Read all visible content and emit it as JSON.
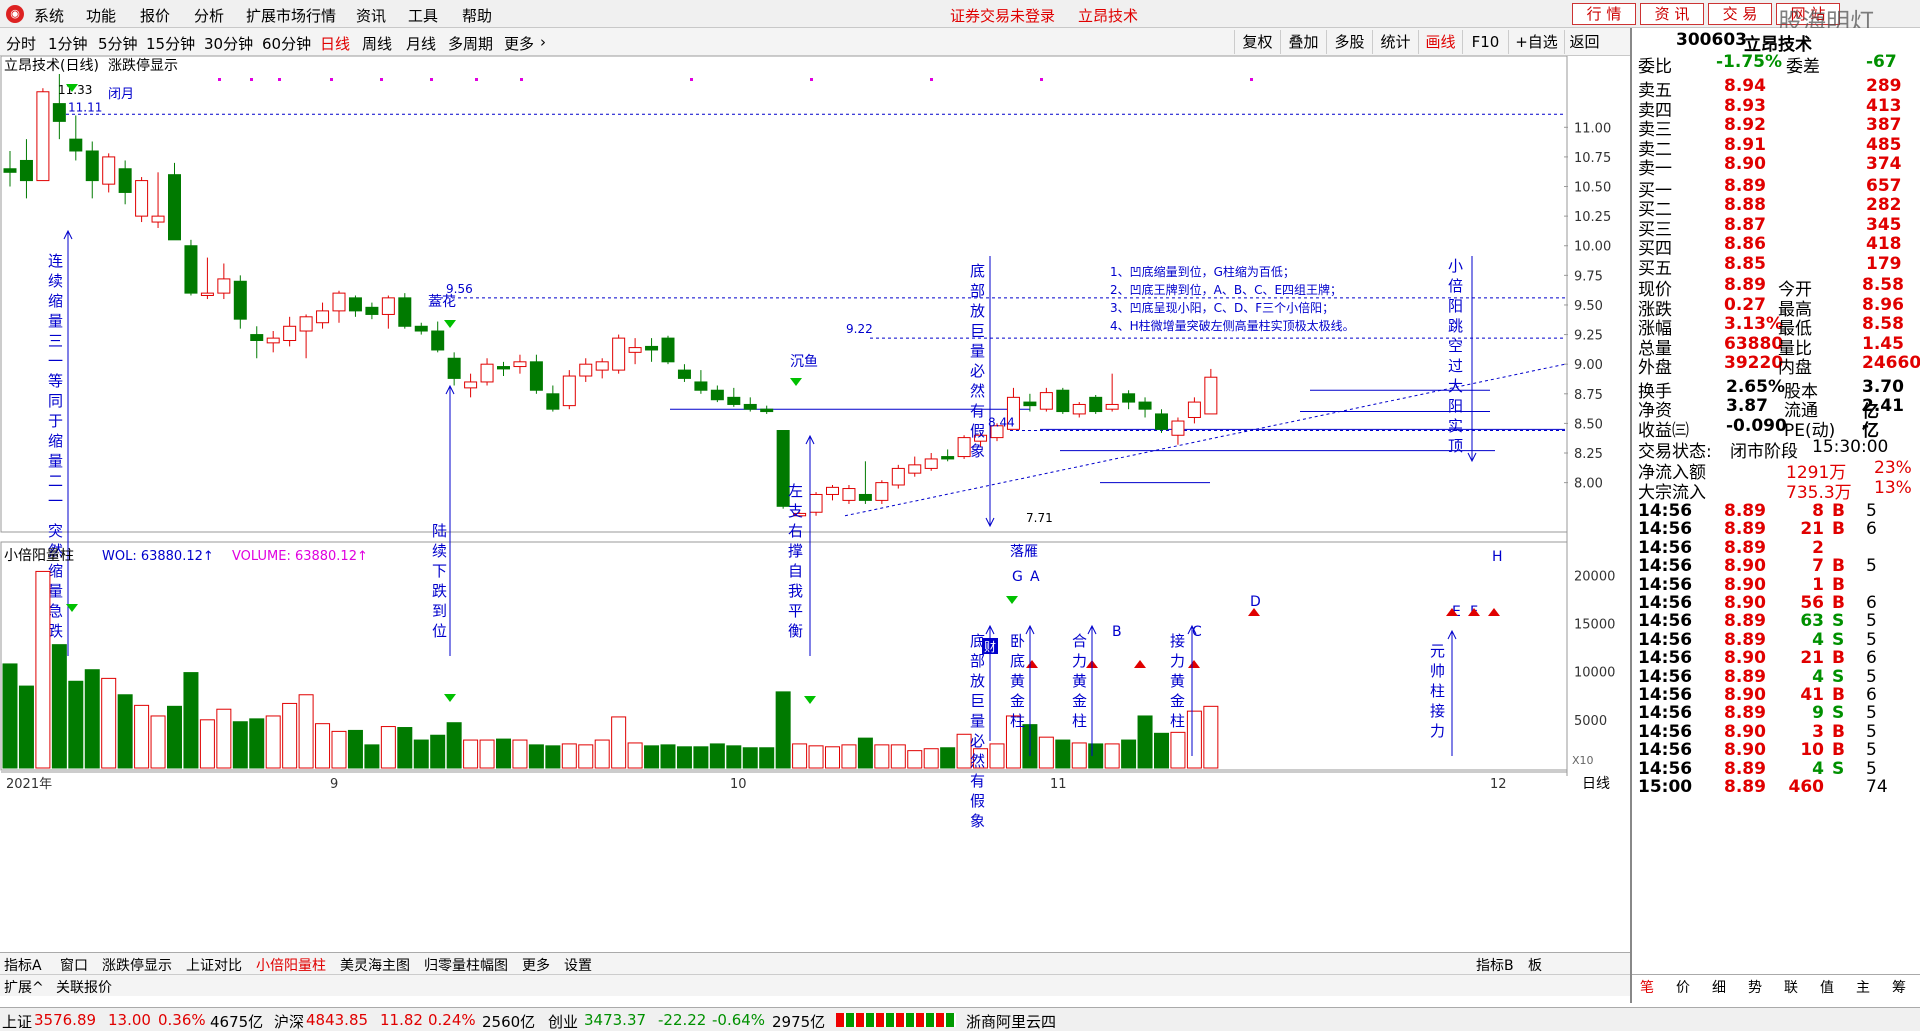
{
  "menu": {
    "items": [
      "系统",
      "功能",
      "报价",
      "分析",
      "扩展市场行情",
      "资讯",
      "工具",
      "帮助"
    ],
    "center_notice": "证券交易未登录",
    "center_title": "立昂技术",
    "top_buttons": [
      "行 情",
      "资 讯",
      "交 易",
      "网 站"
    ],
    "watermark": "股海明灯"
  },
  "periods": {
    "items": [
      "分时",
      "1分钟",
      "5分钟",
      "15分钟",
      "30分钟",
      "60分钟",
      "日线",
      "周线",
      "月线",
      "多周期",
      "更多"
    ],
    "active": "日线",
    "right_buttons": [
      "复权",
      "叠加",
      "多股",
      "统计",
      "画线",
      "F10",
      "+自选",
      "返回"
    ],
    "active_right": "画线"
  },
  "main_chart": {
    "title": "立昂技术(日线)",
    "indicator": "涨跌停显示",
    "y_ticks": [
      "11.00",
      "10.75",
      "10.50",
      "10.25",
      "10.00",
      "9.75",
      "9.50",
      "9.25",
      "9.00",
      "8.75",
      "8.50",
      "8.25",
      "8.00"
    ],
    "price_labels": {
      "high": "11.33",
      "h2": "11.11",
      "p956": "9.56",
      "p922": "9.22",
      "p844": "8.44",
      "low": "7.71"
    },
    "closed_month": "闭月",
    "notes": [
      "1、凹底缩量到位，G柱缩为百低；",
      "2、凹底王牌到位，A、B、C、E四组王牌；",
      "3、凹底呈现小阳，C、D、F三个小倍阳；",
      "4、H柱微增量突破左侧高量柱实顶极太极线。"
    ],
    "vtexts": {
      "t1": "连续缩量三一等同于缩量二一",
      "t2": "突然缩量急跌",
      "t3": "陆续下跌到位",
      "t4": "左支右撑自我平衡",
      "t5": "底部放巨量必然有假象",
      "t6": "小倍阳跳空过大阳实顶"
    },
    "tags": {
      "xuehua": "蓋花",
      "chenyu": "沉鱼",
      "luoyan": "落雁",
      "G": "G",
      "A": "A",
      "B": "B",
      "C": "C",
      "D": "D",
      "E": "E",
      "F": "F",
      "H": "H",
      "cai": "财"
    }
  },
  "volume": {
    "title": "小倍阳量柱",
    "wol": "WOL: 63880.12↑",
    "vol": "VOLUME: 63880.12↑",
    "y_ticks": [
      "20000",
      "15000",
      "10000",
      "5000"
    ],
    "x10": "X10",
    "vtexts": {
      "v1": "底部放巨量必然有假象",
      "v2": "卧底黄金柱",
      "v3": "合力黄金柱",
      "v4": "接力黄金柱",
      "v5": "元帅柱接力"
    }
  },
  "x_axis": {
    "labels": [
      "2021年",
      "9",
      "10",
      "11",
      "12"
    ],
    "period": "日线"
  },
  "bottom_tabs": {
    "row1": [
      "指标A",
      "窗口",
      "涨跌停显示",
      "上证对比",
      "小倍阳量柱",
      "美灵海主图",
      "归零量柱幅图",
      "更多",
      "设置"
    ],
    "active": "小倍阳量柱",
    "right1": [
      "指标B",
      "板"
    ],
    "row2": [
      "扩展^",
      "关联报价"
    ]
  },
  "quote": {
    "code": "300603",
    "name": "立昂技术",
    "weibi": {
      "label": "委比",
      "value": "-1.75%",
      "label2": "委差",
      "value2": "-67"
    },
    "sells": [
      {
        "label": "卖五",
        "price": "8.94",
        "vol": "289"
      },
      {
        "label": "卖四",
        "price": "8.93",
        "vol": "413"
      },
      {
        "label": "卖三",
        "price": "8.92",
        "vol": "387"
      },
      {
        "label": "卖二",
        "price": "8.91",
        "vol": "485"
      },
      {
        "label": "卖一",
        "price": "8.90",
        "vol": "374"
      }
    ],
    "buys": [
      {
        "label": "买一",
        "price": "8.89",
        "vol": "657"
      },
      {
        "label": "买二",
        "price": "8.88",
        "vol": "282"
      },
      {
        "label": "买三",
        "price": "8.87",
        "vol": "345"
      },
      {
        "label": "买四",
        "price": "8.86",
        "vol": "418"
      },
      {
        "label": "买五",
        "price": "8.85",
        "vol": "179"
      }
    ],
    "stats": [
      [
        "现价",
        "8.89",
        "今开",
        "8.58"
      ],
      [
        "涨跌",
        "0.27",
        "最高",
        "8.96"
      ],
      [
        "涨幅",
        "3.13%",
        "最低",
        "8.58"
      ],
      [
        "总量",
        "63880",
        "量比",
        "1.45"
      ],
      [
        "外盘",
        "39220",
        "内盘",
        "24660"
      ]
    ],
    "stats2": [
      [
        "换手",
        "2.65%",
        "股本",
        "3.70亿"
      ],
      [
        "净资",
        "3.87",
        "流通",
        "2.41亿"
      ],
      [
        "收益㈢",
        "-0.090",
        "PE(动)",
        "-"
      ]
    ],
    "state": {
      "label": "交易状态:",
      "value": "闭市阶段",
      "time": "15:30:00"
    },
    "flows": [
      [
        "净流入额",
        "1291万",
        "23%"
      ],
      [
        "大宗流入",
        "735.3万",
        "13%"
      ]
    ],
    "ticks": [
      [
        "14:56",
        "8.89",
        "8",
        "B",
        "5"
      ],
      [
        "14:56",
        "8.89",
        "21",
        "B",
        "6"
      ],
      [
        "14:56",
        "8.89",
        "2",
        "",
        ""
      ],
      [
        "14:56",
        "8.90",
        "7",
        "B",
        "5"
      ],
      [
        "14:56",
        "8.90",
        "1",
        "B",
        ""
      ],
      [
        "14:56",
        "8.90",
        "56",
        "B",
        "6"
      ],
      [
        "14:56",
        "8.89",
        "63",
        "S",
        "5"
      ],
      [
        "14:56",
        "8.89",
        "4",
        "S",
        "5"
      ],
      [
        "14:56",
        "8.90",
        "21",
        "B",
        "6"
      ],
      [
        "14:56",
        "8.89",
        "4",
        "S",
        "5"
      ],
      [
        "14:56",
        "8.90",
        "41",
        "B",
        "6"
      ],
      [
        "14:56",
        "8.89",
        "9",
        "S",
        "5"
      ],
      [
        "14:56",
        "8.90",
        "3",
        "B",
        "5"
      ],
      [
        "14:56",
        "8.90",
        "10",
        "B",
        "5"
      ],
      [
        "14:56",
        "8.89",
        "4",
        "S",
        "5"
      ],
      [
        "15:00",
        "8.89",
        "460",
        "",
        "74"
      ]
    ],
    "tabs": [
      "笔",
      "价",
      "细",
      "势",
      "联",
      "值",
      "主",
      "筹"
    ]
  },
  "status": {
    "sh": {
      "name": "上证",
      "v": "3576.89",
      "c": "13.00",
      "p": "0.36%",
      "a": "4675亿"
    },
    "sz": {
      "name": "沪深",
      "v": "4843.85",
      "c": "11.82",
      "p": "0.24%",
      "a": "2560亿"
    },
    "cy": {
      "name": "创业",
      "v": "3473.37",
      "c": "-22.22",
      "p": "-0.64%",
      "a": "2975亿"
    },
    "cloud": "浙商阿里云四"
  },
  "chart_data": {
    "type": "candlestick",
    "title": "立昂技术(日线)",
    "ylim": [
      7.6,
      11.45
    ],
    "candles": [
      [
        10.65,
        10.8,
        10.5,
        10.62
      ],
      [
        10.72,
        10.9,
        10.4,
        10.55
      ],
      [
        10.55,
        11.33,
        10.55,
        11.3
      ],
      [
        11.2,
        11.45,
        10.9,
        11.05
      ],
      [
        10.9,
        11.1,
        10.72,
        10.8
      ],
      [
        10.8,
        10.88,
        10.4,
        10.55
      ],
      [
        10.52,
        10.78,
        10.45,
        10.75
      ],
      [
        10.65,
        10.72,
        10.35,
        10.45
      ],
      [
        10.25,
        10.58,
        10.2,
        10.55
      ],
      [
        10.2,
        10.62,
        10.15,
        10.25
      ],
      [
        10.6,
        10.7,
        10.05,
        10.05
      ],
      [
        10.0,
        10.05,
        9.58,
        9.6
      ],
      [
        9.58,
        9.9,
        9.55,
        9.6
      ],
      [
        9.6,
        9.85,
        9.55,
        9.72
      ],
      [
        9.7,
        9.75,
        9.3,
        9.38
      ],
      [
        9.25,
        9.32,
        9.05,
        9.2
      ],
      [
        9.18,
        9.28,
        9.1,
        9.22
      ],
      [
        9.2,
        9.4,
        9.15,
        9.32
      ],
      [
        9.28,
        9.42,
        9.05,
        9.4
      ],
      [
        9.35,
        9.52,
        9.3,
        9.45
      ],
      [
        9.45,
        9.62,
        9.35,
        9.6
      ],
      [
        9.56,
        9.58,
        9.4,
        9.45
      ],
      [
        9.48,
        9.52,
        9.38,
        9.42
      ],
      [
        9.42,
        9.58,
        9.3,
        9.56
      ],
      [
        9.56,
        9.6,
        9.3,
        9.32
      ],
      [
        9.32,
        9.35,
        9.25,
        9.28
      ],
      [
        9.28,
        9.36,
        9.1,
        9.12
      ],
      [
        9.05,
        9.1,
        8.82,
        8.88
      ],
      [
        8.8,
        8.92,
        8.72,
        8.85
      ],
      [
        8.85,
        9.05,
        8.82,
        9.0
      ],
      [
        8.98,
        9.02,
        8.9,
        8.96
      ],
      [
        8.98,
        9.08,
        8.92,
        9.02
      ],
      [
        9.02,
        9.08,
        8.75,
        8.78
      ],
      [
        8.75,
        8.82,
        8.6,
        8.62
      ],
      [
        8.65,
        8.95,
        8.62,
        8.9
      ],
      [
        8.9,
        9.05,
        8.85,
        9.0
      ],
      [
        8.95,
        9.05,
        8.88,
        9.02
      ],
      [
        8.95,
        9.25,
        8.92,
        9.22
      ],
      [
        9.1,
        9.22,
        9.0,
        9.14
      ],
      [
        9.15,
        9.22,
        9.02,
        9.12
      ],
      [
        9.22,
        9.24,
        9.0,
        9.02
      ],
      [
        8.95,
        9.0,
        8.85,
        8.88
      ],
      [
        8.85,
        8.95,
        8.75,
        8.78
      ],
      [
        8.78,
        8.82,
        8.68,
        8.7
      ],
      [
        8.72,
        8.8,
        8.64,
        8.66
      ],
      [
        8.66,
        8.72,
        8.6,
        8.62
      ],
      [
        8.62,
        8.65,
        8.58,
        8.6
      ],
      [
        8.44,
        8.44,
        7.78,
        7.8
      ],
      [
        7.72,
        7.75,
        7.71,
        7.74
      ],
      [
        7.75,
        7.92,
        7.72,
        7.9
      ],
      [
        7.9,
        7.98,
        7.85,
        7.96
      ],
      [
        7.85,
        7.98,
        7.82,
        7.95
      ],
      [
        7.9,
        8.18,
        7.82,
        7.85
      ],
      [
        7.85,
        8.02,
        7.82,
        8.0
      ],
      [
        7.98,
        8.15,
        7.95,
        8.12
      ],
      [
        8.08,
        8.22,
        8.05,
        8.15
      ],
      [
        8.12,
        8.25,
        8.1,
        8.2
      ],
      [
        8.22,
        8.28,
        8.18,
        8.2
      ],
      [
        8.22,
        8.4,
        8.2,
        8.38
      ],
      [
        8.35,
        8.42,
        8.3,
        8.4
      ],
      [
        8.38,
        8.5,
        8.35,
        8.48
      ],
      [
        8.45,
        8.8,
        8.45,
        8.72
      ],
      [
        8.68,
        8.75,
        8.6,
        8.65
      ],
      [
        8.62,
        8.8,
        8.6,
        8.76
      ],
      [
        8.78,
        8.8,
        8.58,
        8.6
      ],
      [
        8.58,
        8.68,
        8.55,
        8.66
      ],
      [
        8.72,
        8.74,
        8.58,
        8.6
      ],
      [
        8.62,
        8.92,
        8.6,
        8.66
      ],
      [
        8.75,
        8.78,
        8.62,
        8.68
      ],
      [
        8.68,
        8.72,
        8.55,
        8.62
      ],
      [
        8.58,
        8.62,
        8.42,
        8.45
      ],
      [
        8.4,
        8.55,
        8.32,
        8.52
      ],
      [
        8.55,
        8.72,
        8.5,
        8.68
      ],
      [
        8.58,
        8.96,
        8.58,
        8.89
      ]
    ],
    "volumes": [
      10800,
      8500,
      20400,
      12800,
      9000,
      10200,
      9300,
      7600,
      6500,
      5400,
      6400,
      9900,
      5000,
      6100,
      4800,
      5100,
      5400,
      6700,
      7600,
      4600,
      3800,
      3900,
      2400,
      4300,
      4200,
      2900,
      3400,
      4700,
      2900,
      2900,
      3000,
      2900,
      2400,
      2300,
      2500,
      2400,
      2900,
      5300,
      2600,
      2300,
      2400,
      2200,
      2200,
      2500,
      2300,
      2100,
      2100,
      7900,
      2500,
      2300,
      2200,
      2400,
      3100,
      2400,
      2400,
      1800,
      2000,
      2100,
      3500,
      2000,
      2500,
      5400,
      4500,
      3200,
      2900,
      2600,
      2500,
      2500,
      2900,
      5400,
      3600,
      3700,
      5900,
      6400
    ]
  }
}
